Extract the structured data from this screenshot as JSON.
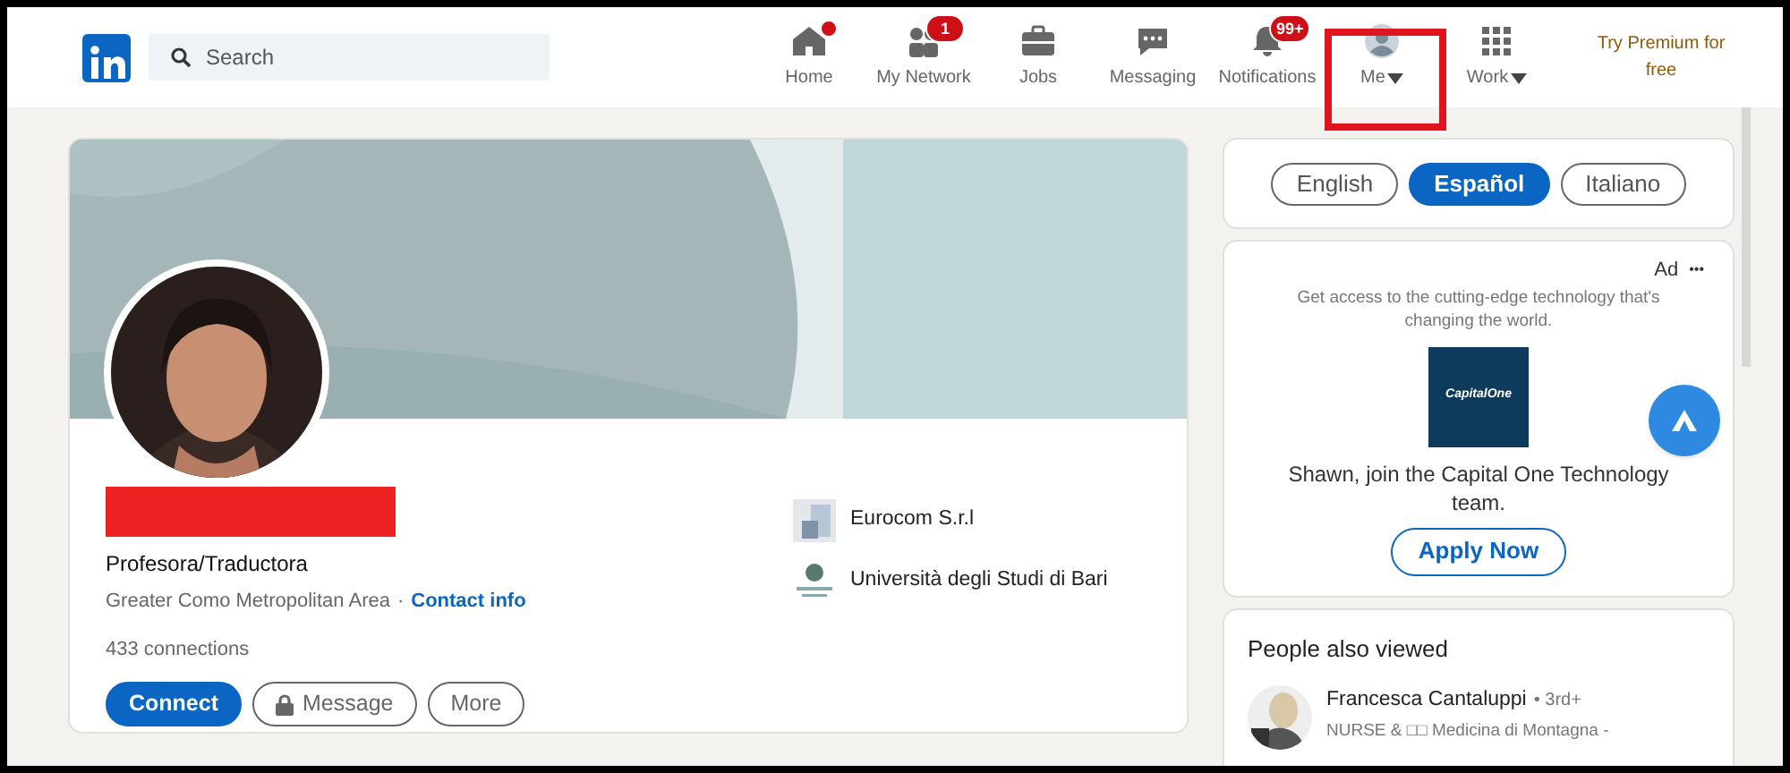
{
  "nav": {
    "search_placeholder": "Search",
    "items": [
      {
        "kind": "home",
        "label": "Home",
        "dot": true,
        "caret": false,
        "highlighted": false
      },
      {
        "kind": "network",
        "label": "My Network",
        "badge": "1",
        "dot": false,
        "caret": false,
        "highlighted": false
      },
      {
        "kind": "jobs",
        "label": "Jobs",
        "dot": false,
        "caret": false,
        "highlighted": false
      },
      {
        "kind": "messaging",
        "label": "Messaging",
        "dot": false,
        "caret": false,
        "highlighted": false
      },
      {
        "kind": "notifications",
        "label": "Notifications",
        "badge": "99+",
        "dot": false,
        "caret": false,
        "highlighted": false
      },
      {
        "kind": "me",
        "label": "Me",
        "dot": false,
        "caret": true,
        "highlighted": true
      },
      {
        "kind": "work",
        "label": "Work",
        "dot": false,
        "caret": true,
        "highlighted": false
      }
    ],
    "premium": "Try Premium for free"
  },
  "profile": {
    "name_redacted": true,
    "headline": "Profesora/Traductora",
    "location": "Greater Como Metropolitan Area",
    "separator": "·",
    "contact_link": "Contact info",
    "connections": "433 connections",
    "buttons": [
      {
        "kind": "primary",
        "label": "Connect"
      },
      {
        "kind": "locked",
        "label": "Message"
      },
      {
        "kind": "outline",
        "label": "More"
      }
    ],
    "organizations": [
      {
        "kind": "company",
        "name": "Eurocom S.r.l"
      },
      {
        "kind": "school",
        "name": "Università degli Studi di Bari"
      }
    ]
  },
  "languages": [
    {
      "label": "English",
      "selected": false
    },
    {
      "label": "Español",
      "selected": true
    },
    {
      "label": "Italiano",
      "selected": false
    }
  ],
  "ad": {
    "label": "Ad",
    "menu": "•••",
    "text": "Get access to the cutting-edge technology that's changing the world.",
    "logo": "CapitalOne",
    "message": "Shawn, join the Capital One Technology team.",
    "button": "Apply Now"
  },
  "people_also_viewed": {
    "title": "People also viewed",
    "people": [
      {
        "name": "Francesca Cantaluppi",
        "degree": "• 3rd+",
        "headline": "NURSE & □□ Medicina di Montagna -"
      }
    ]
  }
}
